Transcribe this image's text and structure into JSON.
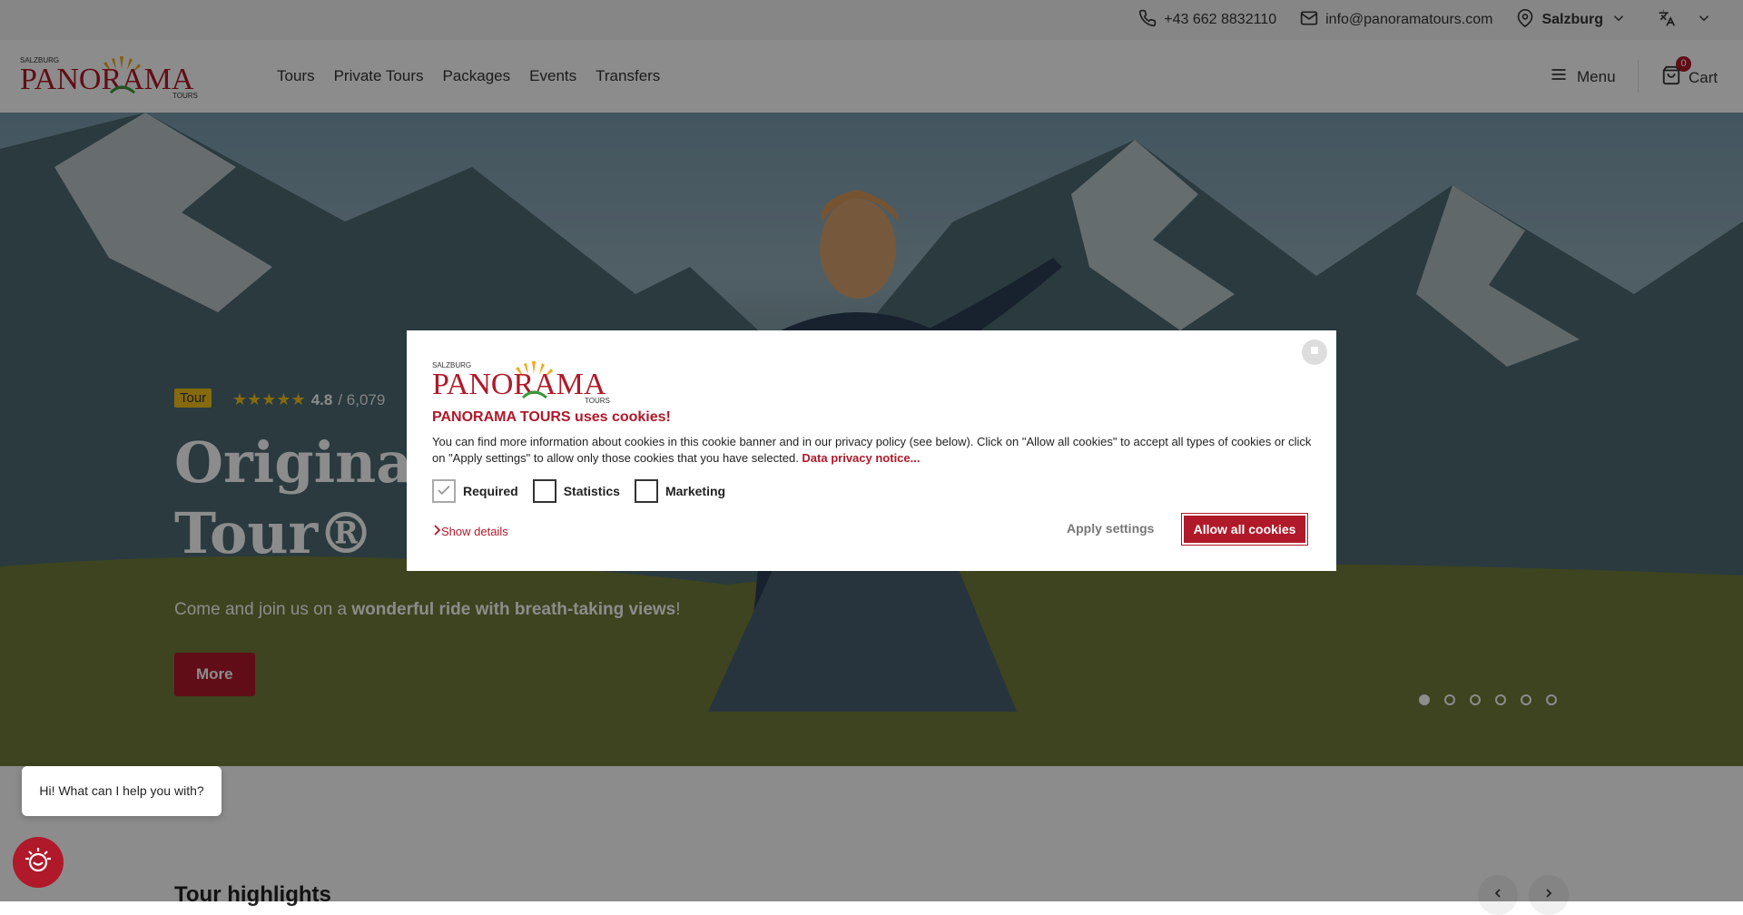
{
  "topbar": {
    "phone": "+43 662 8832110",
    "email": "info@panoramatours.com",
    "location": "Salzburg"
  },
  "logo": {
    "top_text": "SALZBURG",
    "main_text": "PANORAMA",
    "sub_text": "TOURS"
  },
  "nav": {
    "items": [
      "Tours",
      "Private Tours",
      "Packages",
      "Events",
      "Transfers"
    ],
    "menu_label": "Menu",
    "cart_label": "Cart",
    "cart_count": "0"
  },
  "hero": {
    "tag": "Tour",
    "stars": "★★★★★",
    "rating": "4.8",
    "review_count": "/ 6,079",
    "title_line1": "Original",
    "title_line2": "Tour®",
    "subtitle_prefix": "Come and join us on a ",
    "subtitle_bold": "wonderful ride with breath-taking views",
    "subtitle_suffix": "!",
    "more_label": "More",
    "slide_count": 6,
    "active_slide": 1
  },
  "highlights": {
    "heading": "Tour highlights"
  },
  "chat": {
    "bubble_text": "Hi! What can I help you with?"
  },
  "cookie": {
    "title": "PANORAMA TOURS uses cookies!",
    "text": "You can find more information about cookies in this cookie banner and in our privacy policy (see below). Click on \"Allow all cookies\" to accept all types of cookies or click on \"Apply settings\" to allow only those cookies that you have selected. ",
    "privacy_link": "Data privacy notice...",
    "checks": [
      {
        "label": "Required",
        "checked": true
      },
      {
        "label": "Statistics",
        "checked": false
      },
      {
        "label": "Marketing",
        "checked": false
      }
    ],
    "show_details": "Show details",
    "apply_label": "Apply settings",
    "allow_label": "Allow all cookies"
  },
  "colors": {
    "brand_red": "#b0192a",
    "tag_yellow": "#f2c21b"
  }
}
